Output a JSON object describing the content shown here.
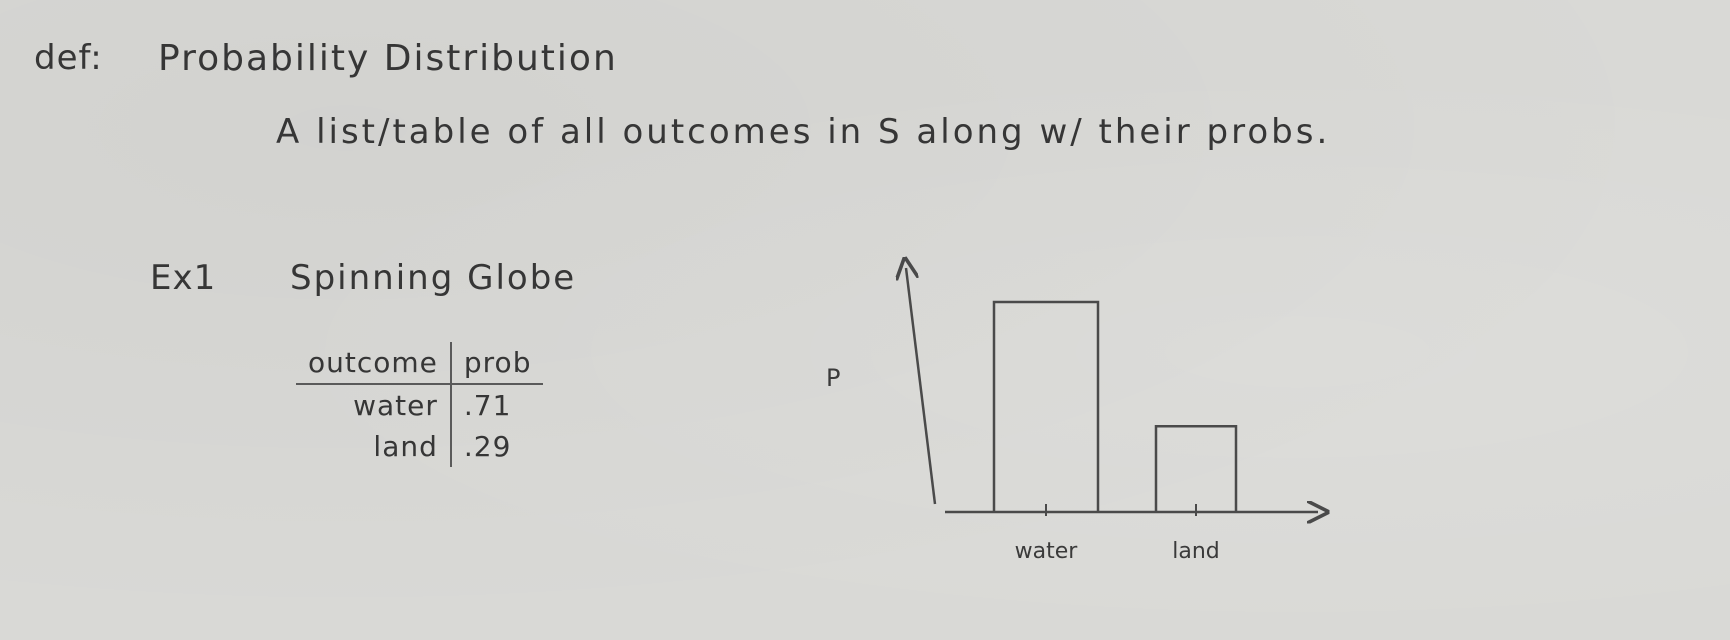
{
  "definition": {
    "label": "def:",
    "title": "Probability Distribution",
    "text": "A list/table of all outcomes in S along w/ their probs."
  },
  "example": {
    "label": "Ex1",
    "title": "Spinning Globe",
    "table": {
      "headers": [
        "outcome",
        "prob"
      ],
      "rows": [
        [
          "water",
          ".71"
        ],
        [
          "land",
          ".29"
        ]
      ]
    }
  },
  "chart_data": {
    "type": "bar",
    "categories": [
      "water",
      "land"
    ],
    "values": [
      0.71,
      0.29
    ],
    "title": "",
    "xlabel": "",
    "ylabel": "P",
    "ylim": [
      0,
      0.71
    ],
    "grid": false
  }
}
